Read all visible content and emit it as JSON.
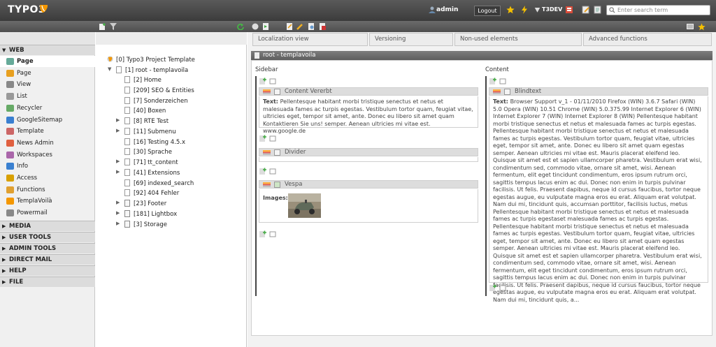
{
  "topbar": {
    "logo": "TYPO3",
    "username": "admin",
    "logout_label": "Logout",
    "t3dev_label": "T3DEV",
    "search_placeholder": "Enter search term",
    "accent": "#f49700"
  },
  "modules": {
    "web_group": "WEB",
    "web_items": [
      {
        "label": "Page",
        "icon": "page-icon",
        "active": true
      },
      {
        "label": "Page",
        "icon": "page-edit-icon"
      },
      {
        "label": "View",
        "icon": "eye-icon"
      },
      {
        "label": "List",
        "icon": "list-icon"
      },
      {
        "label": "Recycler",
        "icon": "recycler-icon"
      },
      {
        "label": "GoogleSitemap",
        "icon": "google-icon"
      },
      {
        "label": "Template",
        "icon": "template-icon"
      },
      {
        "label": "News Admin",
        "icon": "news-icon"
      },
      {
        "label": "Workspaces",
        "icon": "workspaces-icon"
      },
      {
        "label": "Info",
        "icon": "info-icon"
      },
      {
        "label": "Access",
        "icon": "access-icon"
      },
      {
        "label": "Functions",
        "icon": "functions-icon"
      },
      {
        "label": "TemplaVoilà",
        "icon": "templavoila-icon"
      },
      {
        "label": "Powermail",
        "icon": "powermail-icon"
      }
    ],
    "groups": [
      "MEDIA",
      "USER TOOLS",
      "ADMIN TOOLS",
      "DIRECT MAIL",
      "HELP",
      "FILE"
    ]
  },
  "tree": {
    "root_label": "[0] Typo3 Project Template",
    "site_label": "[1] root - templavoila",
    "children": [
      {
        "label": "[2] Home",
        "exp": false
      },
      {
        "label": "[209] SEO & Entities",
        "exp": false
      },
      {
        "label": "[7] Sonderzeichen",
        "exp": false
      },
      {
        "label": "[40] Boxen",
        "exp": false
      },
      {
        "label": "[8] RTE Test",
        "exp": true
      },
      {
        "label": "[11] Submenu",
        "exp": true
      },
      {
        "label": "[16] Testing 4.5.x",
        "exp": false
      },
      {
        "label": "[30] Sprache",
        "exp": false
      },
      {
        "label": "[71] tt_content",
        "exp": true
      },
      {
        "label": "[41] Extensions",
        "exp": true
      },
      {
        "label": "[69] indexed_search",
        "exp": false
      },
      {
        "label": "[92] 404 Fehler",
        "exp": false
      },
      {
        "label": "[23] Footer",
        "exp": true,
        "folder": true
      },
      {
        "label": "[181] Lightbox",
        "exp": true,
        "folder": true
      },
      {
        "label": "[3] Storage",
        "exp": true,
        "folder": true
      }
    ]
  },
  "main": {
    "tabs": [
      "Localization view",
      "Versioning",
      "Non-used elements",
      "Advanced functions"
    ],
    "header": "root - templavoila",
    "sidebar_label": "Sidebar",
    "content_label": "Content",
    "sidebar_elements": [
      {
        "title": "Content Vererbt",
        "text_label": "Text:",
        "text": "Pellentesque habitant morbi tristique senectus et netus et malesuada fames ac turpis egestas. Vestibulum tortor quam, feugiat vitae, ultricies eget, tempor sit amet, ante. Donec eu libero sit amet quam Kontaktieren Sie uns! semper. Aenean ultricies mi vitae est. www.google.de"
      },
      {
        "title": "Divider"
      },
      {
        "title": "Vespa",
        "images_label": "Images:"
      }
    ],
    "content_element": {
      "title": "Blindtext",
      "text_label": "Text:",
      "text": "Browser Support v_1 - 01/11/2010 Firefox (WIN) 3.6.7 Safari (WIN) 5.0 Opera (WIN) 10.51 Chrome (WIN) 5.0.375.99 Internet Explorer 6 (WIN) Internet Explorer 7 (WIN) Internet Explorer 8 (WIN) Pellentesque habitant morbi tristique senectus et netus et malesuada fames ac turpis egestas. Pellentesque habitant morbi tristique senectus et netus et malesuada fames ac turpis egestas. Vestibulum tortor quam, feugiat vitae, ultricies eget, tempor sit amet, ante. Donec eu libero sit amet quam egestas semper. Aenean ultricies mi vitae est. Mauris placerat eleifend leo. Quisque sit amet est et sapien ullamcorper pharetra. Vestibulum erat wisi, condimentum sed, commodo vitae, ornare sit amet, wisi. Aenean fermentum, elit eget tincidunt condimentum, eros ipsum rutrum orci, sagittis tempus lacus enim ac dui. Donec non enim in turpis pulvinar facilisis. Ut felis. Praesent dapibus, neque id cursus faucibus, tortor neque egestas augue, eu vulputate magna eros eu erat. Aliquam erat volutpat. Nam dui mi, tincidunt quis, accumsan porttitor, facilisis luctus, metus Pellentesque habitant morbi tristique senectus et netus et malesuada fames ac turpis egestaset malesuada fames ac turpis egestas. Pellentesque habitant morbi tristique senectus et netus et malesuada fames ac turpis egestas. Vestibulum tortor quam, feugiat vitae, ultricies eget, tempor sit amet, ante. Donec eu libero sit amet quam egestas semper. Aenean ultricies mi vitae est. Mauris placerat eleifend leo. Quisque sit amet est et sapien ullamcorper pharetra. Vestibulum erat wisi, condimentum sed, commodo vitae, ornare sit amet, wisi. Aenean fermentum, elit eget tincidunt condimentum, eros ipsum rutrum orci, sagittis tempus lacus enim ac dui. Donec non enim in turpis pulvinar facilisis. Ut felis. Praesent dapibus, neque id cursus faucibus, tortor neque egestas augue, eu vulputate magna eros eu erat. Aliquam erat volutpat. Nam dui mi, tincidunt quis, a..."
    }
  }
}
